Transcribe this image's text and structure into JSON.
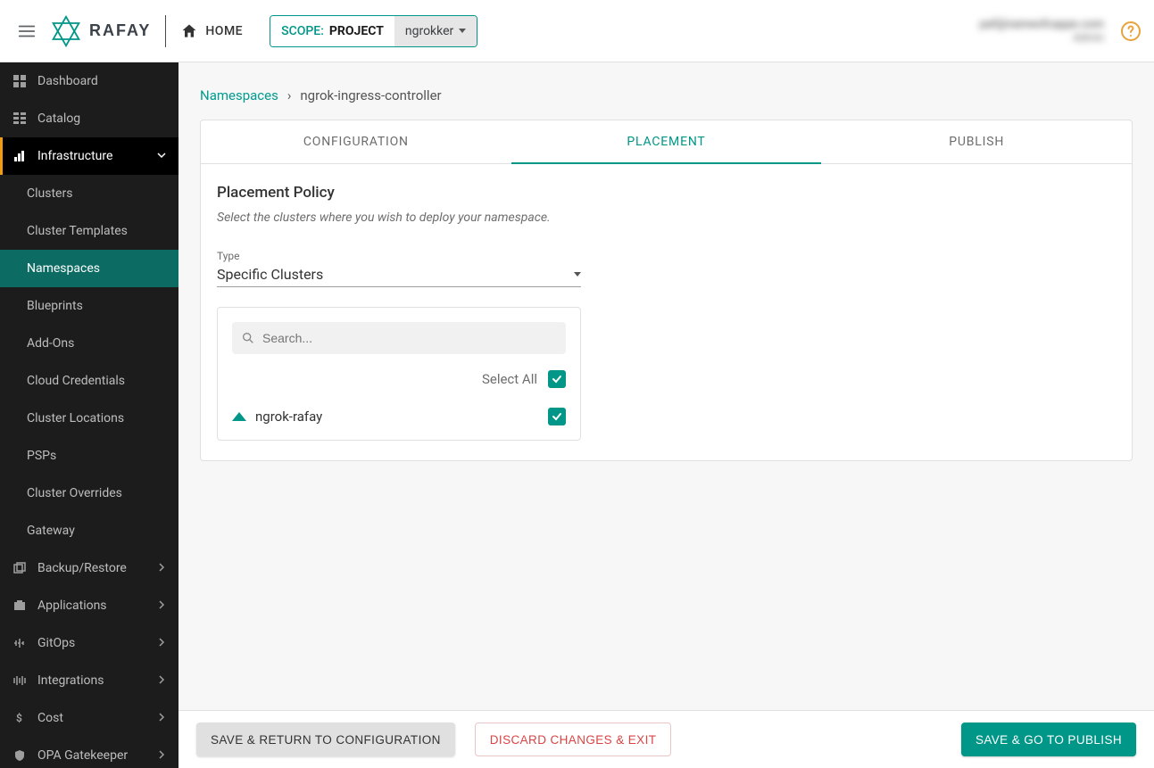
{
  "header": {
    "brand": "RAFAY",
    "home_label": "HOME",
    "scope_prefix": "SCOPE:",
    "scope_type": "PROJECT",
    "scope_value": "ngrokker",
    "user_line1": "paf@nameofcappe.com",
    "user_line2": "Admin"
  },
  "sidebar": {
    "items": [
      {
        "label": "Dashboard"
      },
      {
        "label": "Catalog"
      }
    ],
    "infra_label": "Infrastructure",
    "infra_subs": [
      "Clusters",
      "Cluster Templates",
      "Namespaces",
      "Blueprints",
      "Add-Ons",
      "Cloud Credentials",
      "Cluster Locations",
      "PSPs",
      "Cluster Overrides",
      "Gateway"
    ],
    "after": [
      "Backup/Restore",
      "Applications",
      "GitOps",
      "Integrations",
      "Cost",
      "OPA Gatekeeper"
    ]
  },
  "breadcrumb": {
    "root": "Namespaces",
    "sep": "›",
    "current": "ngrok-ingress-controller"
  },
  "tabs": {
    "configuration": "CONFIGURATION",
    "placement": "PLACEMENT",
    "publish": "PUBLISH"
  },
  "placement": {
    "title": "Placement Policy",
    "subtitle": "Select the clusters where you wish to deploy your namespace.",
    "type_label": "Type",
    "type_value": "Specific Clusters",
    "search_placeholder": "Search...",
    "select_all_label": "Select All",
    "clusters": [
      {
        "name": "ngrok-rafay",
        "checked": true
      }
    ]
  },
  "footer": {
    "back_label": "SAVE & RETURN TO CONFIGURATION",
    "discard_label": "DISCARD CHANGES & EXIT",
    "next_label": "SAVE & GO TO PUBLISH"
  },
  "colors": {
    "teal": "#009688",
    "orange": "#f39c12"
  }
}
